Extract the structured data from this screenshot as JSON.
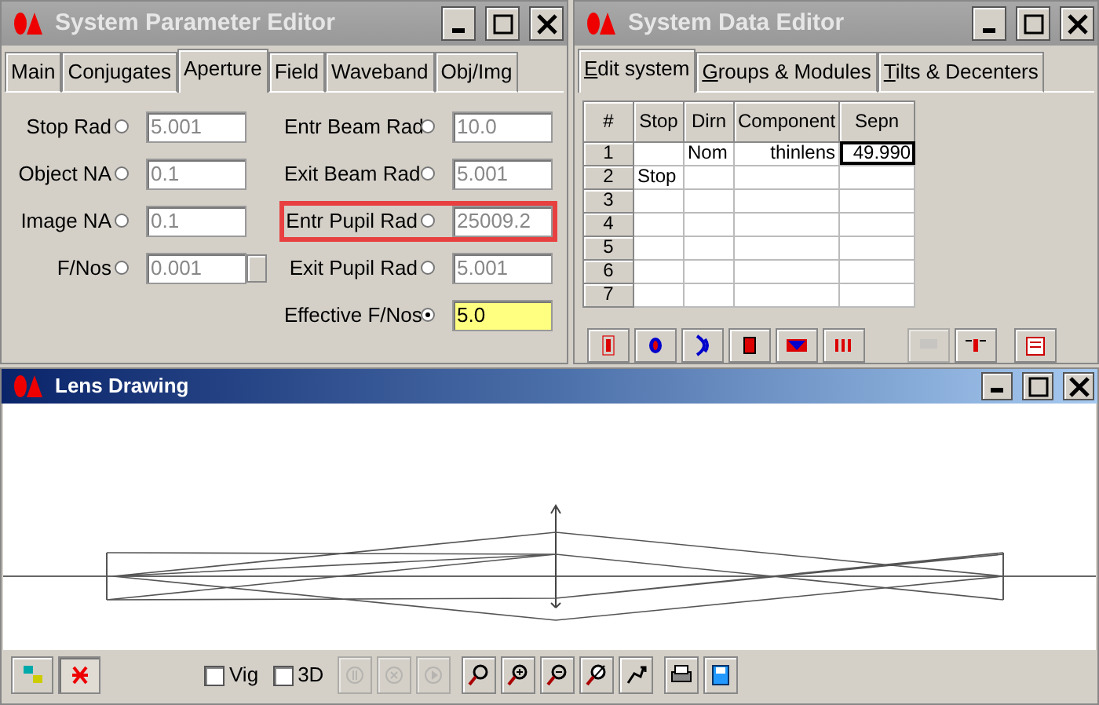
{
  "parameter_editor": {
    "title": "System Parameter Editor",
    "tabs": [
      {
        "label": "Main",
        "selected": false
      },
      {
        "label": "Conjugates",
        "selected": false
      },
      {
        "label": "Aperture",
        "selected": true
      },
      {
        "label": "Field",
        "selected": false
      },
      {
        "label": "Waveband",
        "selected": false
      },
      {
        "label": "Obj/Img",
        "selected": false
      }
    ],
    "left_fields": [
      {
        "label": "Stop Rad",
        "value": "5.001",
        "selected": false,
        "kind": "plain"
      },
      {
        "label": "Object NA",
        "value": "0.1",
        "selected": false,
        "kind": "plain"
      },
      {
        "label": "Image NA",
        "value": "0.1",
        "selected": false,
        "kind": "plain"
      },
      {
        "label": "F/Nos",
        "value": "0.001",
        "selected": false,
        "kind": "with_button"
      }
    ],
    "right_fields": [
      {
        "label": "Entr Beam Rad",
        "value": "10.0",
        "selected": false,
        "highlighted": false
      },
      {
        "label": "Exit Beam Rad",
        "value": "5.001",
        "selected": false,
        "highlighted": false
      },
      {
        "label": "Entr Pupil Rad",
        "value": "25009.2",
        "selected": false,
        "highlighted": true
      },
      {
        "label": "Exit Pupil Rad",
        "value": "5.001",
        "selected": false,
        "highlighted": false
      },
      {
        "label": "Effective F/Nos",
        "value": "5.0",
        "selected": true,
        "highlighted": false
      }
    ]
  },
  "data_editor": {
    "title": "System Data Editor",
    "tabs": [
      {
        "label": "Edit system",
        "selected": true
      },
      {
        "label": "Groups & Modules",
        "selected": false
      },
      {
        "label": "Tilts & Decenters",
        "selected": false
      }
    ],
    "table": {
      "columns": [
        "#",
        "Stop",
        "Dirn",
        "Component",
        "Sepn"
      ],
      "rows": [
        {
          "cells": [
            {
              "text": "1",
              "selected": false
            },
            {
              "text": "",
              "selected": false
            },
            {
              "text": "Nom",
              "selected": false
            },
            {
              "text": "thinlens",
              "selected": false
            },
            {
              "text": "49.990",
              "selected": true
            }
          ]
        },
        {
          "cells": [
            {
              "text": "2",
              "selected": false
            },
            {
              "text": "Stop",
              "selected": false
            },
            {
              "text": "",
              "selected": false
            },
            {
              "text": "",
              "selected": false
            },
            {
              "text": "",
              "selected": false
            }
          ]
        },
        {
          "cells": [
            {
              "text": "3",
              "selected": false
            },
            {
              "text": "",
              "selected": false
            },
            {
              "text": "",
              "selected": false
            },
            {
              "text": "",
              "selected": false
            },
            {
              "text": "",
              "selected": false
            }
          ]
        },
        {
          "cells": [
            {
              "text": "4",
              "selected": false
            },
            {
              "text": "",
              "selected": false
            },
            {
              "text": "",
              "selected": false
            },
            {
              "text": "",
              "selected": false
            },
            {
              "text": "",
              "selected": false
            }
          ]
        },
        {
          "cells": [
            {
              "text": "5",
              "selected": false
            },
            {
              "text": "",
              "selected": false
            },
            {
              "text": "",
              "selected": false
            },
            {
              "text": "",
              "selected": false
            },
            {
              "text": "",
              "selected": false
            }
          ]
        },
        {
          "cells": [
            {
              "text": "6",
              "selected": false
            },
            {
              "text": "",
              "selected": false
            },
            {
              "text": "",
              "selected": false
            },
            {
              "text": "",
              "selected": false
            },
            {
              "text": "",
              "selected": false
            }
          ]
        },
        {
          "cells": [
            {
              "text": "7",
              "selected": false
            },
            {
              "text": "",
              "selected": false
            },
            {
              "text": "",
              "selected": false
            },
            {
              "text": "",
              "selected": false
            },
            {
              "text": "",
              "selected": false
            }
          ]
        }
      ]
    },
    "toolbar": [
      {
        "kind": "thinlens",
        "disabled": false
      },
      {
        "kind": "lens",
        "disabled": false
      },
      {
        "kind": "mirror",
        "disabled": false
      },
      {
        "kind": "block",
        "disabled": false
      },
      {
        "kind": "prism",
        "disabled": false
      },
      {
        "kind": "break",
        "disabled": false
      },
      {
        "kind": "library",
        "disabled": true
      },
      {
        "kind": "component",
        "disabled": false
      },
      {
        "kind": "form",
        "disabled": false
      }
    ]
  },
  "lens_drawing": {
    "title": "Lens Drawing",
    "left_buttons": [
      {
        "kind": "rays",
        "selected": false
      },
      {
        "kind": "bug",
        "selected": true
      }
    ],
    "checkboxes": [
      {
        "label": "Vig",
        "checked": false
      },
      {
        "label": "3D",
        "checked": false
      }
    ],
    "buttons": [
      {
        "kind": "pause",
        "disabled": true
      },
      {
        "kind": "stop",
        "disabled": true
      },
      {
        "kind": "play",
        "disabled": true
      },
      {
        "kind": "zoom",
        "disabled": false
      },
      {
        "kind": "zoom-in",
        "disabled": false
      },
      {
        "kind": "zoom-out",
        "disabled": false
      },
      {
        "kind": "zoom-fit",
        "disabled": false
      },
      {
        "kind": "pan",
        "disabled": false
      },
      {
        "kind": "print",
        "disabled": false
      },
      {
        "kind": "save",
        "disabled": false
      }
    ]
  }
}
